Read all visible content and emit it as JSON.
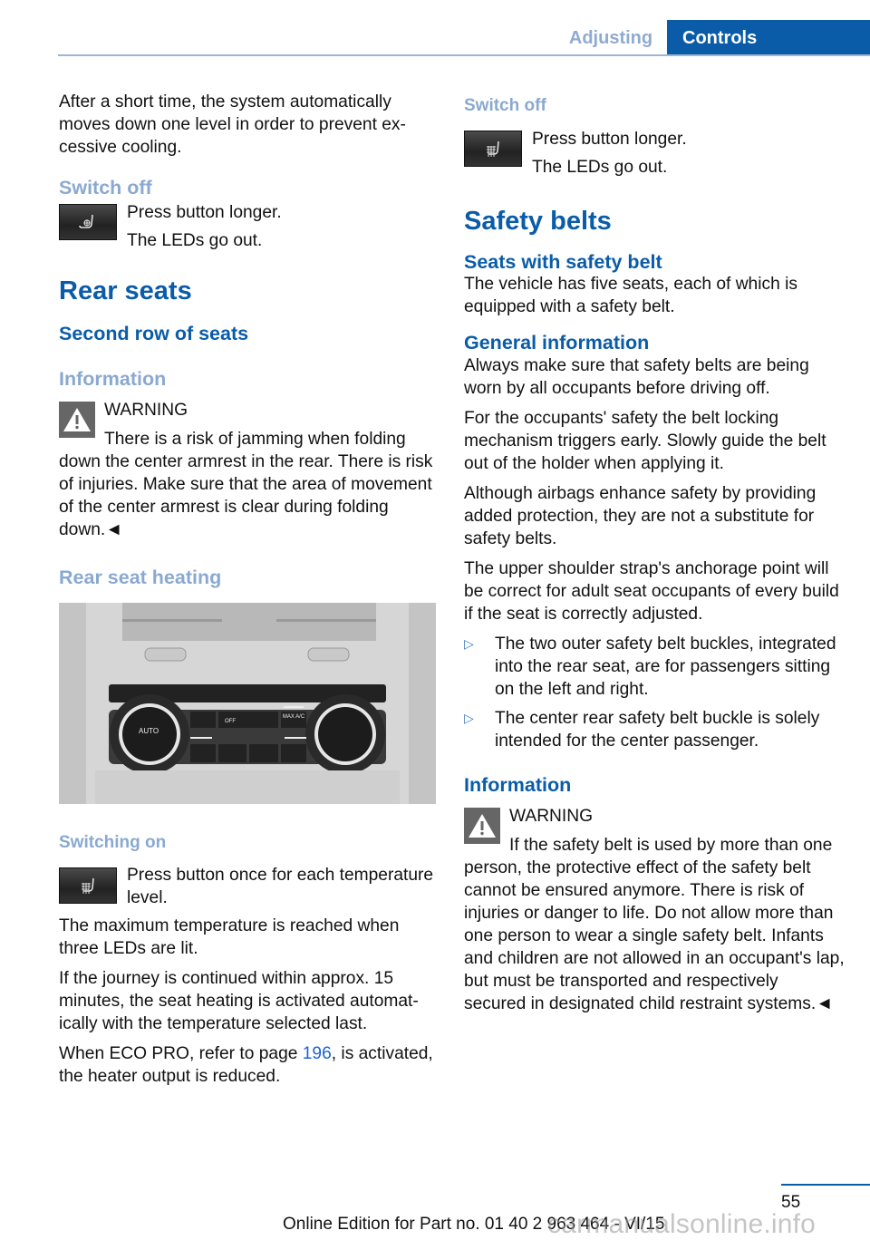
{
  "header": {
    "tabs": [
      {
        "label": "Adjusting",
        "active": false
      },
      {
        "label": "Controls",
        "active": true
      }
    ]
  },
  "left": {
    "intro": "After a short time, the system automatically moves down one level in order to prevent ex­cessive cooling.",
    "switch_off": {
      "heading": "Switch off",
      "button_icon": "seat-ventilation-icon",
      "line1": "Press button longer.",
      "line2": "The LEDs go out."
    },
    "rear_seats_title": "Rear seats",
    "second_row_title": "Second row of seats",
    "information_title": "Information",
    "warning": {
      "label": "WARNING",
      "text": "There is a risk of jamming when folding down the center armrest in the rear. There is risk of injuries. Make sure that the area of movement of the center armrest is clear during folding down.◄"
    },
    "rear_seat_heating_title": "Rear seat heating",
    "image": {
      "alt": "Rear climate control panel with seat heating buttons",
      "labels": {
        "auto": "AUTO",
        "off": "OFF",
        "max_ac": "MAX A/C"
      }
    },
    "switching_on": {
      "heading": "Switching on",
      "button_icon": "seat-heating-icon",
      "text": "Press button once for each tempera­ture level."
    },
    "para_max_temp": "The maximum temperature is reached when three LEDs are lit.",
    "para_journey": "If the journey is continued within approx. 15 minutes, the seat heating is activated automat­ically with the temperature selected last.",
    "eco_pro": {
      "before": "When ECO PRO, refer to page ",
      "link": "196",
      "after": ", is acti­vated, the heater output is reduced."
    }
  },
  "right": {
    "switch_off": {
      "heading": "Switch off",
      "button_icon": "seat-heating-icon",
      "line1": "Press button longer.",
      "line2": "The LEDs go out."
    },
    "safety_belts_title": "Safety belts",
    "seats_with_belt_title": "Seats with safety belt",
    "seats_with_belt_text": "The vehicle has five seats, each of which is equipped with a safety belt.",
    "general_info_title": "General information",
    "general_paras": [
      "Always make sure that safety belts are being worn by all occupants before driving off.",
      "For the occupants' safety the belt locking mechanism triggers early. Slowly guide the belt out of the holder when applying it.",
      "Although airbags enhance safety by providing added protection, they are not a substitute for safety belts.",
      "The upper shoulder strap's anchorage point will be correct for adult seat occupants of ev­ery build if the seat is correctly adjusted."
    ],
    "bullets": [
      "The two outer safety belt buckles, integrated into the rear seat, are for pas­sengers sitting on the left and right.",
      "The center rear safety belt buckle is solely intended for the center passenger."
    ],
    "information_title": "Information",
    "warning": {
      "label": "WARNING",
      "text": "If the safety belt is used by more than one person, the protective effect of the safety belt cannot be ensured anymore. There is risk of injuries or danger to life. Do not allow more than one person to wear a single safety belt. Infants and children are not allowed in an occu­pant's lap, but must be transported and re­spectively secured in designated child restraint systems.◄"
    }
  },
  "footer": {
    "page_number": "55",
    "edition": "Online Edition for Part no. 01 40 2 963 464 - VI/15",
    "watermark": "carmanualsonline.info"
  },
  "colors": {
    "brand_blue": "#0a5ca8",
    "light_blue": "#8aa9d1",
    "link_blue": "#1c63d6"
  }
}
